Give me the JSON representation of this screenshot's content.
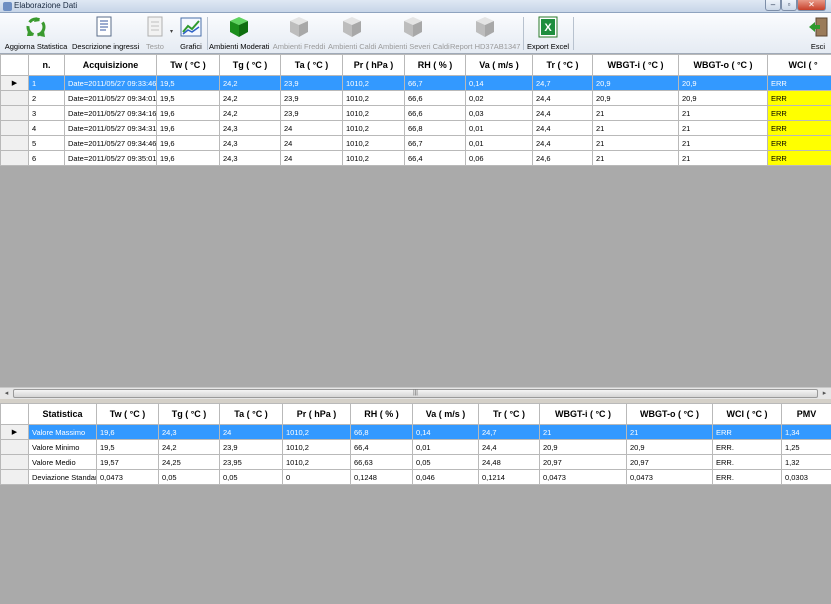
{
  "window": {
    "title": "Elaborazione Dati"
  },
  "toolbar": {
    "aggiorna": "Aggiorna Statistica",
    "descrizione": "Descrizione ingressi",
    "testo": "Testo",
    "grafici": "Grafici",
    "moderati": "Ambienti Moderati",
    "freddi": "Ambienti Freddi",
    "caldi": "Ambienti Caldi",
    "severi": "Ambienti Severi Caldi",
    "report": "Report HD37AB1347",
    "export": "Export Excel",
    "esci": "Esci"
  },
  "data_grid": {
    "headers": [
      "n.",
      "Acquisizione",
      "Tw ( °C )",
      "Tg ( °C )",
      "Ta ( °C )",
      "Pr ( hPa )",
      "RH ( % )",
      "Va ( m/s )",
      "Tr ( °C )",
      "WBGT-i ( °C )",
      "WBGT-o ( °C )",
      "WCI ( °"
    ],
    "rows": [
      [
        "1",
        "Date=2011/05/27 09:33:46",
        "19,5",
        "24,2",
        "23,9",
        "1010,2",
        "66,7",
        "0,14",
        "24,7",
        "20,9",
        "20,9",
        "ERR"
      ],
      [
        "2",
        "Date=2011/05/27 09:34:01",
        "19,5",
        "24,2",
        "23,9",
        "1010,2",
        "66,6",
        "0,02",
        "24,4",
        "20,9",
        "20,9",
        "ERR"
      ],
      [
        "3",
        "Date=2011/05/27 09:34:16",
        "19,6",
        "24,2",
        "23,9",
        "1010,2",
        "66,6",
        "0,03",
        "24,4",
        "21",
        "21",
        "ERR"
      ],
      [
        "4",
        "Date=2011/05/27 09:34:31",
        "19,6",
        "24,3",
        "24",
        "1010,2",
        "66,8",
        "0,01",
        "24,4",
        "21",
        "21",
        "ERR"
      ],
      [
        "5",
        "Date=2011/05/27 09:34:46",
        "19,6",
        "24,3",
        "24",
        "1010,2",
        "66,7",
        "0,01",
        "24,4",
        "21",
        "21",
        "ERR"
      ],
      [
        "6",
        "Date=2011/05/27 09:35:01",
        "19,6",
        "24,3",
        "24",
        "1010,2",
        "66,4",
        "0,06",
        "24,6",
        "21",
        "21",
        "ERR"
      ]
    ]
  },
  "scrollbar": {
    "grip": "|||"
  },
  "stats_grid": {
    "headers": [
      "Statistica",
      "Tw ( °C )",
      "Tg ( °C )",
      "Ta ( °C )",
      "Pr ( hPa )",
      "RH ( % )",
      "Va ( m/s )",
      "Tr ( °C )",
      "WBGT-i ( °C )",
      "WBGT-o ( °C )",
      "WCI ( °C )",
      "PMV"
    ],
    "rows": [
      [
        "Valore Massimo",
        "19,6",
        "24,3",
        "24",
        "1010,2",
        "66,8",
        "0,14",
        "24,7",
        "21",
        "21",
        "ERR",
        "1,34"
      ],
      [
        "Valore Minimo",
        "19,5",
        "24,2",
        "23,9",
        "1010,2",
        "66,4",
        "0,01",
        "24,4",
        "20,9",
        "20,9",
        "ERR.",
        "1,25"
      ],
      [
        "Valore Medio",
        "19,57",
        "24,25",
        "23,95",
        "1010,2",
        "66,63",
        "0,05",
        "24,48",
        "20,97",
        "20,97",
        "ERR.",
        "1,32"
      ],
      [
        "Deviazione Standard",
        "0,0473",
        "0,05",
        "0,05",
        "0",
        "0,1248",
        "0,046",
        "0,1214",
        "0,0473",
        "0,0473",
        "ERR.",
        "0,0303"
      ]
    ]
  }
}
